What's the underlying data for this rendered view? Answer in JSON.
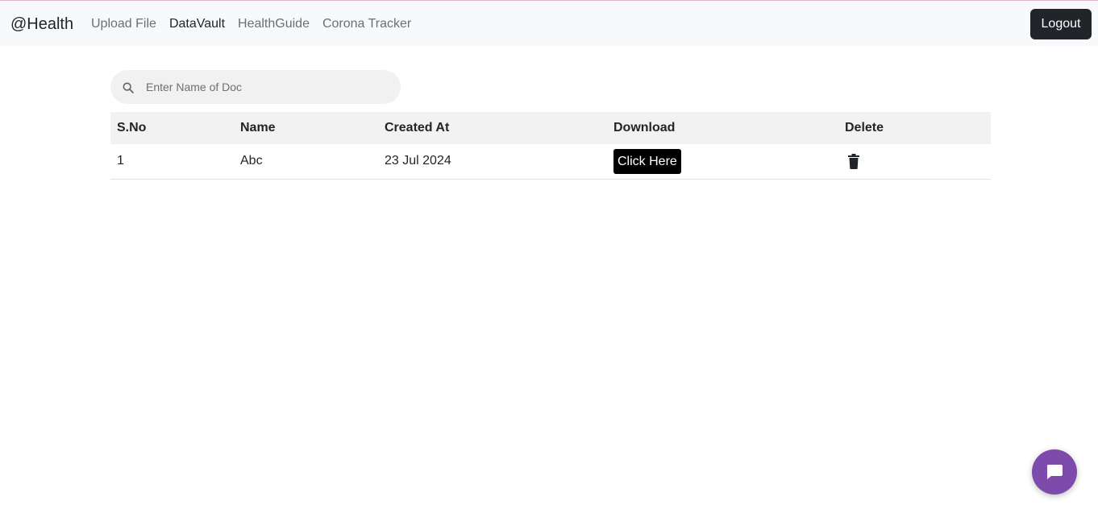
{
  "nav": {
    "brand": "@Health",
    "links": [
      {
        "label": "Upload File",
        "active": false
      },
      {
        "label": "DataVault",
        "active": true
      },
      {
        "label": "HealthGuide",
        "active": false
      },
      {
        "label": "Corona Tracker",
        "active": false
      }
    ],
    "logout_label": "Logout"
  },
  "search": {
    "placeholder": "Enter Name of Doc",
    "icon": "search-icon"
  },
  "table": {
    "headers": [
      "S.No",
      "Name",
      "Created At",
      "Download",
      "Delete"
    ],
    "rows": [
      {
        "sno": "1",
        "name": "Abc",
        "created_at": "23 Jul 2024",
        "download_label": "Click Here",
        "delete_icon": "trash-icon"
      }
    ]
  },
  "chat": {
    "icon": "chat-bubble-icon",
    "color": "#7c4bab"
  }
}
